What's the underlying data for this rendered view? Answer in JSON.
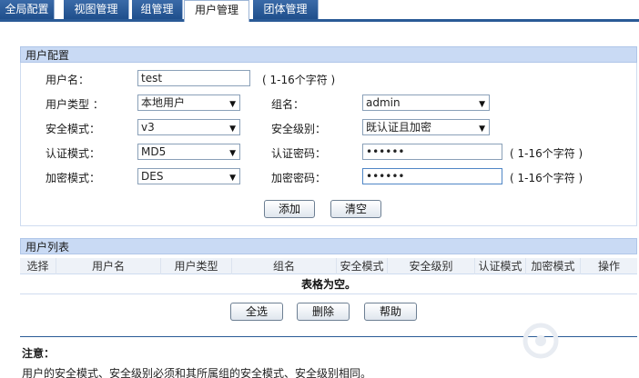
{
  "tabs": [
    {
      "label": "全局配置",
      "active": false
    },
    {
      "label": "视图管理",
      "active": false
    },
    {
      "label": "组管理",
      "active": false
    },
    {
      "label": "用户管理",
      "active": true
    },
    {
      "label": "团体管理",
      "active": false
    }
  ],
  "user_config": {
    "header": "用户配置",
    "username_label": "用户名：",
    "username_value": "test",
    "username_hint": "( 1-16个字符 )",
    "user_type_label": "用户类型 ：",
    "user_type_value": "本地用户",
    "group_label": "组名：",
    "group_value": "admin",
    "security_mode_label": "安全模式：",
    "security_mode_value": "v3",
    "security_level_label": "安全级别：",
    "security_level_value": "既认证且加密",
    "auth_mode_label": "认证模式：",
    "auth_mode_value": "MD5",
    "auth_pwd_label": "认证密码：",
    "auth_pwd_value": "••••••",
    "auth_pwd_hint": "( 1-16个字符 )",
    "enc_mode_label": "加密模式：",
    "enc_mode_value": "DES",
    "enc_pwd_label": "加密密码：",
    "enc_pwd_value": "••••••",
    "enc_pwd_hint": "( 1-16个字符 )",
    "add_button": "添加",
    "clear_button": "清空"
  },
  "user_list": {
    "header": "用户列表",
    "columns": [
      "选择",
      "用户名",
      "用户类型",
      "组名",
      "安全模式",
      "安全级别",
      "认证模式",
      "加密模式",
      "操作"
    ],
    "empty_text": "表格为空。",
    "select_all_button": "全选",
    "delete_button": "删除",
    "help_button": "帮助"
  },
  "note": {
    "title": "注意：",
    "text": "用户的安全模式、安全级别必须和其所属组的安全模式、安全级别相同。"
  },
  "colors": {
    "tab_bg": "#2a5a96",
    "section_header_bg": "#c9daf4"
  }
}
